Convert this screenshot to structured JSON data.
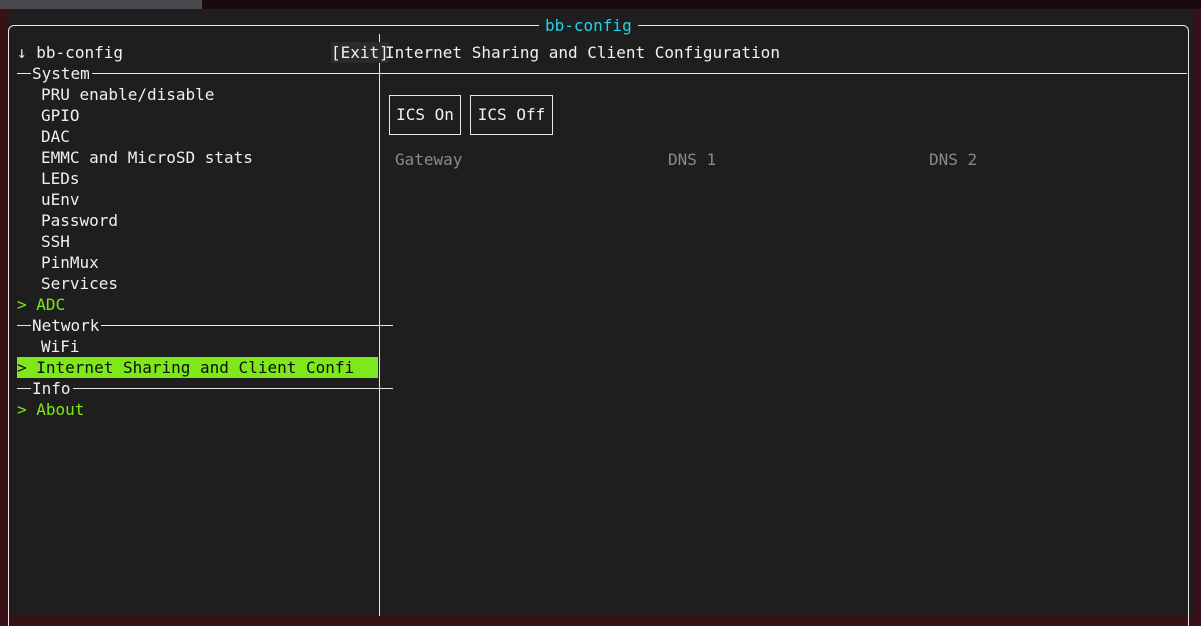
{
  "window": {
    "title": "bb-config"
  },
  "sidebar": {
    "arrow": "↓",
    "title": "bb-config",
    "exit_label": "[Exit]",
    "sections": [
      {
        "label": "System"
      },
      {
        "label": "Network"
      },
      {
        "label": "Info"
      }
    ],
    "system_items": [
      {
        "label": "PRU enable/disable"
      },
      {
        "label": "GPIO"
      },
      {
        "label": "DAC"
      },
      {
        "label": "EMMC and MicroSD stats"
      },
      {
        "label": "LEDs"
      },
      {
        "label": "uEnv"
      },
      {
        "label": "Password"
      },
      {
        "label": "SSH"
      },
      {
        "label": "PinMux"
      },
      {
        "label": "Services"
      },
      {
        "label": "> ADC"
      }
    ],
    "network_items": [
      {
        "label": "WiFi"
      },
      {
        "label": "> Internet Sharing and Client Confi"
      }
    ],
    "info_items": [
      {
        "label": "> About"
      }
    ]
  },
  "panel": {
    "title": "Internet Sharing and Client Configuration",
    "buttons": {
      "ics_on": "ICS On",
      "ics_off": "ICS Off"
    },
    "columns": {
      "gateway": "Gateway",
      "dns1": "DNS 1",
      "dns2": "DNS 2"
    }
  },
  "colors": {
    "accent_green": "#7ee81a",
    "title_cyan": "#22d3ee",
    "background": "#1e1e1e",
    "muted_text": "#8a8a8a"
  }
}
